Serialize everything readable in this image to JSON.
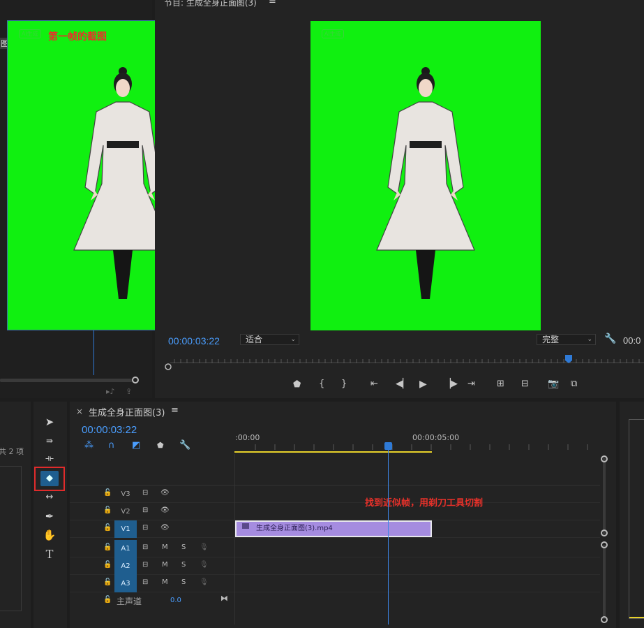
{
  "source_monitor": {
    "annotation": "第一帧的截图",
    "ai_badge": "AI生成",
    "side_label": "图("
  },
  "program_monitor": {
    "title": "节目: 生成全身正面图(3)",
    "menu_icon": "≡",
    "ai_badge": "AI生成",
    "timecode": "00:00:03:22",
    "fit_select": "适合",
    "quality_select": "完整",
    "right_timecode": "00:0"
  },
  "project_panel": {
    "count_label": "共 2 项"
  },
  "timeline": {
    "tab_title": "生成全身正面图(3)",
    "close_icon": "×",
    "menu_icon": "≡",
    "timecode": "00:00:03:22",
    "ruler_start": ":00:00",
    "ruler_mid": "00:00:05:00",
    "annotation": "找到近似帧，用剃刀工具切割",
    "clip_name": "生成全身正面图(3).mp4",
    "tracks": [
      {
        "name": "V3",
        "type": "video",
        "active": false
      },
      {
        "name": "V2",
        "type": "video",
        "active": false
      },
      {
        "name": "V1",
        "type": "video",
        "active": true
      },
      {
        "name": "A1",
        "type": "audio",
        "active": true
      },
      {
        "name": "A2",
        "type": "audio",
        "active": true
      },
      {
        "name": "A3",
        "type": "audio",
        "active": true
      }
    ],
    "mute_label": "M",
    "solo_label": "S",
    "master_label": "主声道",
    "master_value": "0.0"
  },
  "colors": {
    "accent": "#4a9eff",
    "annotation": "#e8312a",
    "green_screen": "#10f010",
    "clip": "#a58ce0",
    "highlight_box": "#e02b2b"
  }
}
